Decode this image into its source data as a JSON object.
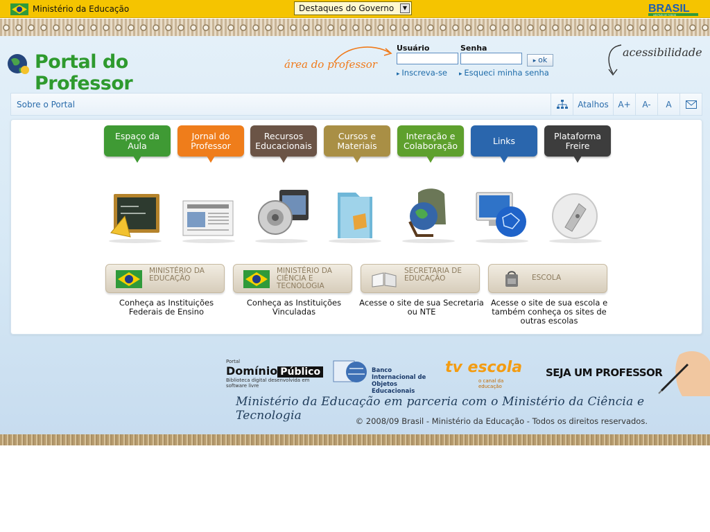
{
  "govbar": {
    "ministry": "Ministério da Educação",
    "select_value": "Destaques do Governo",
    "brand": "BRASIL",
    "brand_tagline": "UM PAÍS DE TODOS"
  },
  "header": {
    "site_title": "Portal do Professor",
    "area_label": "área do professor",
    "login": {
      "user_label": "Usuário",
      "password_label": "Senha",
      "ok_label": "ok",
      "signup_link": "Inscreva-se",
      "forgot_link": "Esqueci minha senha"
    },
    "accessibility": "acessibilidade"
  },
  "nav": {
    "about": "Sobre o Portal",
    "shortcuts": "Atalhos",
    "font_increase": "A+",
    "font_decrease": "A-",
    "font_reset": "A"
  },
  "menu": [
    {
      "label": "Espaço da Aula",
      "color": "#3f9a34"
    },
    {
      "label": "Jornal do Professor",
      "color": "#ef7d1b"
    },
    {
      "label": "Recursos Educacionais",
      "color": "#6b5446"
    },
    {
      "label": "Cursos e Materiais",
      "color": "#a98f45"
    },
    {
      "label": "Interação e Colaboração",
      "color": "#5ea02d"
    },
    {
      "label": "Links",
      "color": "#2a66ad"
    },
    {
      "label": "Plataforma Freire",
      "color": "#3d3d3d"
    }
  ],
  "institutions": [
    {
      "label": "MINISTÉRIO DA EDUCAÇÃO",
      "desc": "Conheça as Instituições Federais de Ensino"
    },
    {
      "label": "MINISTÉRIO DA CIÊNCIA E TECNOLOGIA",
      "desc": "Conheça as Instituições Vinculadas"
    },
    {
      "label": "SECRETARIA DE EDUCAÇÃO",
      "desc": "Acesse o site de sua Secretaria ou NTE"
    },
    {
      "label": "ESCOLA",
      "desc": "Acesse o site de sua escola e também conheça os sites de outras escolas"
    }
  ],
  "partners": {
    "dominio_small": "Portal",
    "dominio_name": "Domínio",
    "dominio_pub": "Público",
    "dominio_sub": "Biblioteca digital desenvolvida em software livre",
    "bioe": "Banco Internacional de Objetos Educacionais",
    "tvescola": "tv escola",
    "tvescola_sub": "o canal da educação",
    "seja": "SEJA UM PROFESSOR"
  },
  "footer": {
    "partnership": "Ministério da Educação em parceria com o Ministério da Ciência e Tecnologia",
    "copyright": "© 2008/09 Brasil - Ministério da Educação - Todos os direitos reservados."
  }
}
